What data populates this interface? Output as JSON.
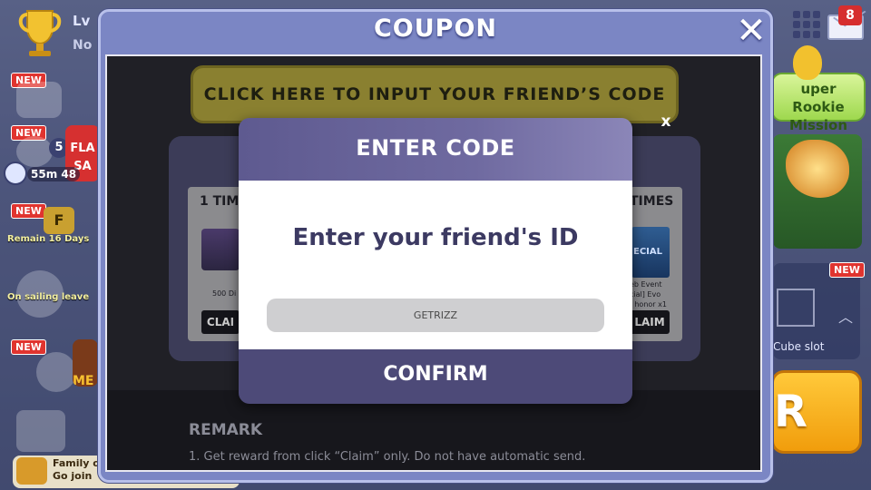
{
  "hud": {
    "level_prefix": "Lv",
    "level_sub": "No",
    "mail_count": "8"
  },
  "left_sidebar": {
    "new_tag": "NEW",
    "flash_sale": "FLA SA",
    "timer": "55m 48",
    "remain": "Remain 16 Days",
    "sailing": "On sailing leave",
    "family_line1": "Family o",
    "family_line2": "Go join",
    "badge_number": "5",
    "badge_letter": "F",
    "me_label": "ME"
  },
  "right_sidebar": {
    "rookie_line1": "uper Rookie",
    "rookie_line2": "Mission",
    "cube_new": "NEW",
    "cube_label": "Cube slot",
    "big_button": "R"
  },
  "coupon": {
    "title": "COUPON",
    "close_icon": "close-icon",
    "friend_code_button": "CLICK HERE TO INPUT YOUR FRIEND’S CODE",
    "left_card": {
      "title": "1 TIM",
      "item": "500 Di",
      "claim": "CLAI"
    },
    "right_card": {
      "title": "TIMES",
      "thumb_text": "ECIAL",
      "item_line1": "eb Event",
      "item_line2": "cial] Evo",
      "item_line3": "f honor x1",
      "claim": "LAIM"
    },
    "remark_title": "REMARK",
    "remark_line1": "1. Get reward from click “Claim” only. Do not have automatic send."
  },
  "enter_code": {
    "close_label": "x",
    "title": "ENTER CODE",
    "prompt": "Enter your friend's ID",
    "input_value": "GETRIZZ",
    "confirm": "CONFIRM"
  }
}
